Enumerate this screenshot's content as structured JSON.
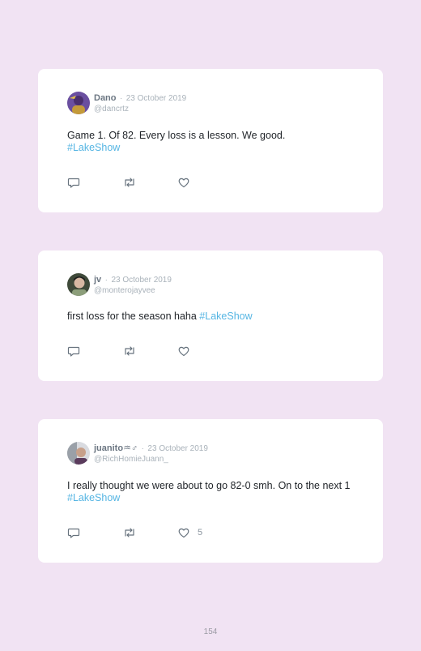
{
  "tweets": [
    {
      "name": "Dano",
      "date": "23 October 2019",
      "handle": "@dancrtz",
      "text": "Game 1. Of 82. Every loss is a lesson. We good.",
      "hashtag": "#LakeShow",
      "likes": "",
      "avatar_colors": [
        "#6a4fa0",
        "#c49a3a"
      ]
    },
    {
      "name": "jv",
      "date": "23 October 2019",
      "handle": "@monterojayvee",
      "text": "first loss for the season haha",
      "hashtag": "#LakeShow",
      "likes": "",
      "avatar_colors": [
        "#3f4a3a",
        "#d7b8a3"
      ]
    },
    {
      "name": "juanito♒♂",
      "date": "23 October 2019",
      "handle": "@RichHomieJuann_",
      "text": "I really thought we were about to go 82-0 smh. On to the next 1",
      "hashtag": "#LakeShow",
      "likes": "5",
      "avatar_colors": [
        "#9aa0a8",
        "#5a3b5c"
      ]
    }
  ],
  "separator": "·",
  "icons": {
    "reply": "reply-icon",
    "retweet": "retweet-icon",
    "like": "heart-icon"
  },
  "colors": {
    "background": "#f1e3f3",
    "hashtag": "#55b5e3",
    "icon": "#66727d"
  },
  "page_number": "154"
}
